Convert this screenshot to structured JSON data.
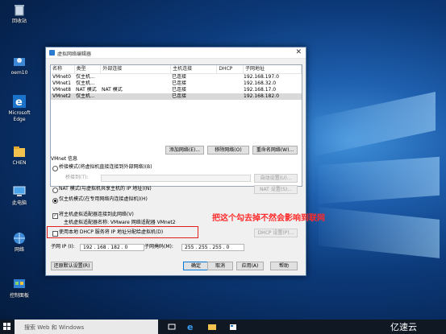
{
  "desktop": {
    "icons": [
      {
        "label": "回收站",
        "icon": "recycle-bin-icon"
      },
      {
        "label": "oem10",
        "icon": "user-folder-icon"
      },
      {
        "label": "Microsoft Edge",
        "icon": "edge-icon"
      },
      {
        "label": "CHEN",
        "icon": "folder-icon"
      },
      {
        "label": "此电脑",
        "icon": "computer-icon"
      },
      {
        "label": "网络",
        "icon": "network-icon"
      },
      {
        "label": "控制面板",
        "icon": "control-panel-icon"
      }
    ]
  },
  "window": {
    "title": "虚拟网络编辑器",
    "close": "✕",
    "table": {
      "headers": [
        "名称",
        "类型",
        "外部连接",
        "主机连接",
        "DHCP",
        "子网地址"
      ],
      "rows": [
        [
          "VMnet0",
          "仅主机...",
          "",
          "已连接",
          "",
          "192.168.197.0"
        ],
        [
          "VMnet1",
          "仅主机...",
          "",
          "已连接",
          "",
          "192.168.32.0"
        ],
        [
          "VMnet8",
          "NAT 模式",
          "NAT 模式",
          "已连接",
          "",
          "192.168.17.0"
        ],
        [
          "VMnet2",
          "仅主机...",
          "",
          "已连接",
          "",
          "192.168.182.0"
        ]
      ],
      "selected_row": 3
    },
    "buttons": {
      "add": "添加网络(E)...",
      "remove": "移除网络(O)",
      "rename": "重命名网络(W)...",
      "auto": "自动设置(U)...",
      "nat": "NAT 设置(S)...",
      "dhcp": "DHCP 设置(P)...",
      "restore": "还原默认设置(R)",
      "ok": "确定",
      "cancel": "取消",
      "apply": "应用(A)",
      "help": "帮助"
    },
    "info": {
      "heading": "VMnet 信息",
      "bridge_mode": "桥接模式(将虚拟机直接连接到外部网络)(B)",
      "bridge_to": "桥接到(T):",
      "nat_mode": "NAT 模式(与虚拟机共享主机的 IP 地址)(N)",
      "host_only": "仅主机模式(在专用网络内连接虚拟机)(H)",
      "connect_adapter": "将主机虚拟适配器连接到此网络(V)",
      "adapter_name_label": "主机虚拟适配器名称: VMware 网络适配器 VMnet2",
      "use_dhcp": "使用本地 DHCP 服务将 IP 地址分配给虚拟机(D)",
      "subnet_ip_label": "子网 IP (I):",
      "subnet_ip": "192 . 168 . 182 . 0",
      "mask_label": "子网掩码(M):",
      "mask": "255 . 255 . 255 . 0",
      "selected_mode": "host_only",
      "connect_adapter_checked": true,
      "use_dhcp_checked": false
    }
  },
  "annotation": {
    "text": "把这个勾去掉不然会影响到联网",
    "color": "#e02020"
  },
  "taskbar": {
    "search_placeholder": "搜索 Web 和 Windows"
  },
  "watermark": {
    "text": "亿速云"
  }
}
